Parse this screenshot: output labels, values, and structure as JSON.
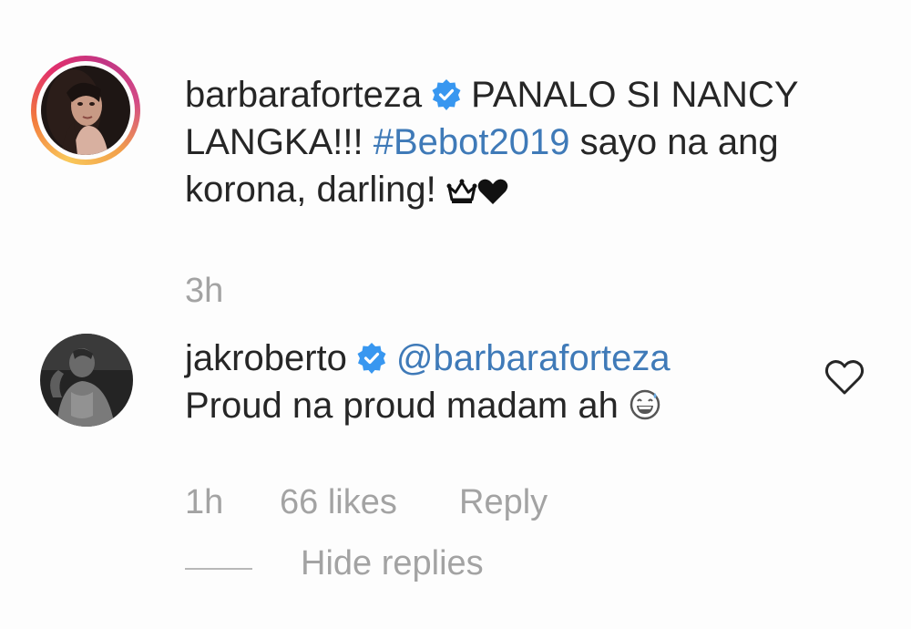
{
  "comments": [
    {
      "username": "barbaraforteza",
      "verified": true,
      "text_parts": {
        "before_hashtag": "PANALO SI NANCY LANGKA!!! ",
        "hashtag": "#Bebot2019",
        "after_hashtag": " sayo na ang korona, darling! "
      },
      "emojis": [
        "crown-emoji",
        "black-heart-emoji"
      ],
      "time": "3h"
    },
    {
      "username": "jakroberto",
      "verified": true,
      "mention": "@barbaraforteza",
      "text": "Proud na proud madam ah ",
      "emojis": [
        "grinning-sweat-emoji"
      ],
      "time": "1h",
      "likes": "66 likes",
      "reply_label": "Reply",
      "hide_replies_label": "Hide replies"
    }
  ],
  "colors": {
    "text": "#262626",
    "meta": "#a3a3a3",
    "link": "#3f7ab8",
    "verified": "#3897f0"
  },
  "icons": {
    "verified": "verified-badge-icon",
    "like": "heart-outline-icon"
  }
}
